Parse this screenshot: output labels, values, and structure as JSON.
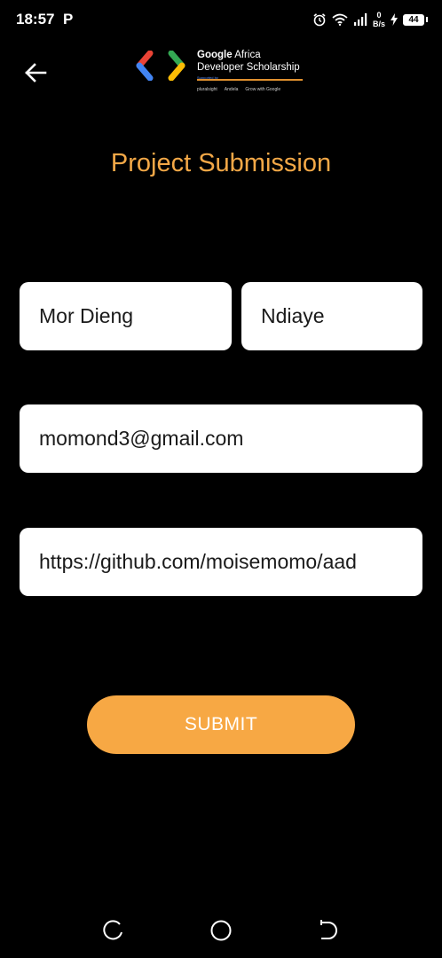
{
  "status_bar": {
    "time": "18:57",
    "app_indicator": "P",
    "net_speed_value": "0",
    "net_speed_unit": "B/s",
    "battery": "44",
    "icons": [
      "alarm-icon",
      "wifi-icon",
      "signal-icon",
      "charging-icon",
      "battery-icon"
    ]
  },
  "header": {
    "back_icon": "arrow-left-icon",
    "logo": {
      "line1_brand": "Google",
      "line1_rest": "Africa",
      "line2": "Developer Scholarship",
      "supported": "Supported by",
      "partners": [
        "pluralsight",
        "Andela",
        "Grow with Google"
      ]
    }
  },
  "page": {
    "title": "Project Submission"
  },
  "form": {
    "first_name": "Mor Dieng",
    "last_name": "Ndiaye",
    "email": "momond3@gmail.com",
    "project_link": "https://github.com/moisemomo/aad",
    "submit_label": "SUBMIT"
  },
  "colors": {
    "background": "#000000",
    "accent": "#f3a847",
    "button": "#f7a844",
    "field": "#ffffff"
  },
  "nav_bar": {
    "icons": [
      "recent-apps-icon",
      "home-icon",
      "back-icon"
    ]
  }
}
